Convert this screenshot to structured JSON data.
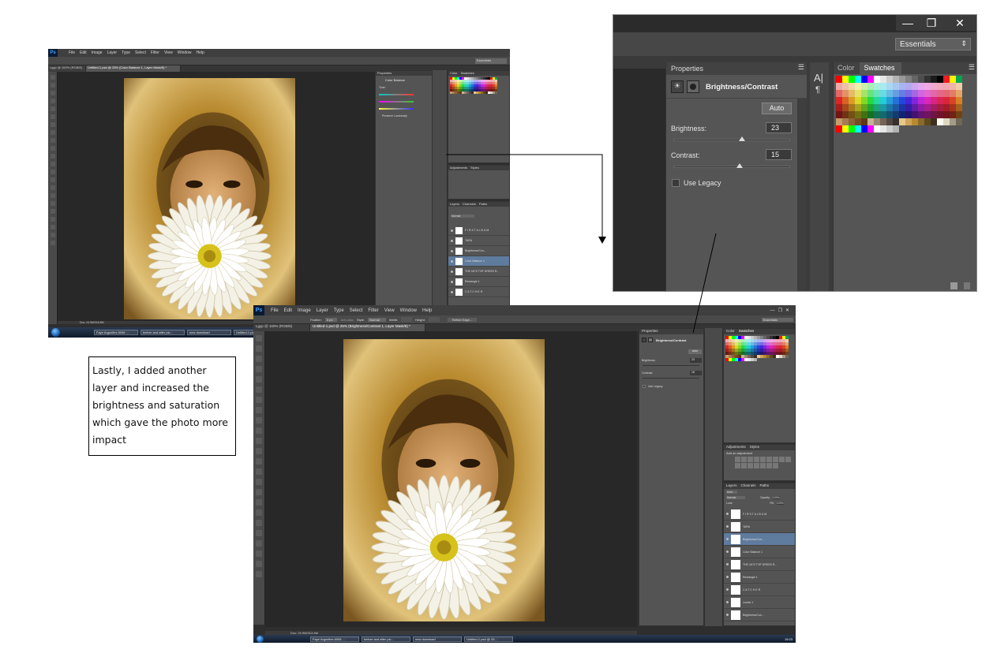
{
  "ps_menu": {
    "logo": "Ps",
    "items": [
      "File",
      "Edit",
      "Image",
      "Layer",
      "Type",
      "Select",
      "Filter",
      "View",
      "Window",
      "Help"
    ]
  },
  "ps_window_1": {
    "tabs": [
      "Lgyp @ 100% (RGB/8)",
      "Untitled-1.psd @ 25% (Color Balance 1, Layer Mask/8) *"
    ],
    "workspace": "Essentials",
    "panels": {
      "properties_title": "Properties",
      "properties_sub": "Color Balance",
      "tone_label": "Tone:",
      "tone_value": "Midtones",
      "preserve": "Preserve Luminosity",
      "color_tab": "Color",
      "swatches_tab": "Swatches",
      "adjustments_tab": "Adjustments",
      "styles_tab": "Styles",
      "layers_tab": "Layers",
      "channels_tab": "Channels",
      "paths_tab": "Paths",
      "blend_mode": "Normal",
      "layers": [
        "F I R S T A L B U M",
        "TARA",
        "Brightness/Con...",
        "Color Balance 1",
        "THE UK'S TOP DRESS R...",
        "Rectangle 1",
        "C A T C H E R"
      ]
    },
    "status": "Doc: 24.9M/316.8M",
    "taskbar": [
      "Faye Arguelles 6008 ...",
      "before and after pic...",
      "new download",
      "Untitled-1.psd @ 25..."
    ]
  },
  "ps_window_2": {
    "tabs": [
      "Lgyp @ 100% (RGB/8)",
      "Untitled-1.psd @ 25% (Brightness/Contrast 1, Layer Mask/8) *"
    ],
    "workspace": "Essentials",
    "options": [
      "Feather:",
      "0 px",
      "Anti-alias",
      "Style:",
      "Normal",
      "Width:",
      "Height:",
      "Refine Edge..."
    ],
    "panels": {
      "properties_title": "Properties",
      "properties_sub": "Brightness/Contrast",
      "auto": "Auto",
      "brightness_label": "Brightness:",
      "brightness_value": "23",
      "contrast_label": "Contrast:",
      "contrast_value": "15",
      "use_legacy": "Use Legacy",
      "color_tab": "Color",
      "swatches_tab": "Swatches",
      "adjustments_tab": "Adjustments",
      "styles_tab": "Styles",
      "add_adjustment": "Add an adjustment",
      "layers_tab": "Layers",
      "channels_tab": "Channels",
      "paths_tab": "Paths",
      "kind": "Kind",
      "blend_mode": "Normal",
      "opacity_label": "Opacity:",
      "opacity_value": "100%",
      "lock_label": "Lock:",
      "fill_label": "Fill:",
      "fill_value": "100%",
      "layers": [
        "F I R S T A L B U M",
        "TARA",
        "Brightness/Con...",
        "Color Balance 1",
        "THE UK'S TOP DRESS R...",
        "Rectangle 1",
        "C A T C H E R",
        "Levels 1",
        "Brightness/Con..."
      ]
    },
    "status": "Doc: 24.9M/313.8M",
    "taskbar": [
      "Faye Arguelles 6008 ...",
      "before and after pic...",
      "new download",
      "Untitled-1.psd @ 25..."
    ],
    "clock": "19:23"
  },
  "zoom": {
    "workspace": "Essentials",
    "properties_title": "Properties",
    "properties_sub": "Brightness/Contrast",
    "auto": "Auto",
    "brightness_label": "Brightness:",
    "brightness_value": "23",
    "brightness_slider": 0.58,
    "contrast_label": "Contrast:",
    "contrast_value": "15",
    "contrast_slider": 0.56,
    "use_legacy": "Use Legacy",
    "color_tab": "Color",
    "swatches_tab": "Swatches"
  },
  "callout": {
    "text": "Lastly, I added another layer and increased the brightness and saturation which gave the photo more impact"
  },
  "colors": {
    "ps_dark": "#2e2e2e",
    "panel": "#545454",
    "fur": "#b8892e",
    "flower": "#f4f1e6",
    "flower_center": "#d7c21b"
  }
}
